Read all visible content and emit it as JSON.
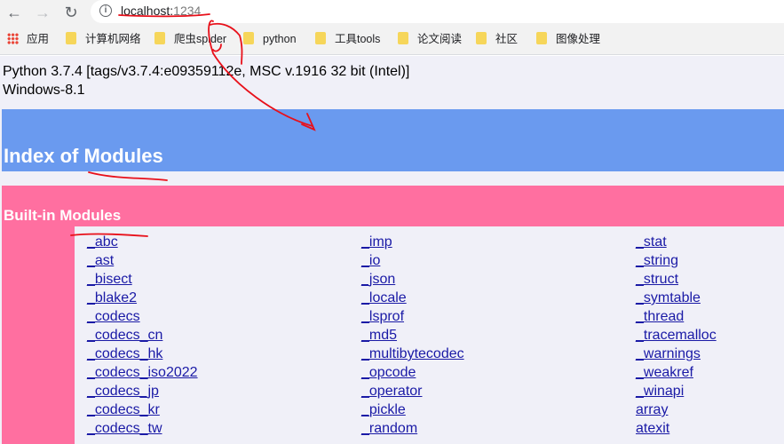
{
  "browser": {
    "url_host": "localhost:",
    "url_port": "1234",
    "info_glyph": "i"
  },
  "bookmarks": [
    {
      "label": "应用",
      "icon": "apps-grid-icon"
    },
    {
      "label": "计算机网络",
      "icon": "folder-icon"
    },
    {
      "label": "爬虫spider",
      "icon": "folder-icon"
    },
    {
      "label": "python",
      "icon": "folder-icon"
    },
    {
      "label": "工具tools",
      "icon": "folder-icon"
    },
    {
      "label": "论文阅读",
      "icon": "folder-icon"
    },
    {
      "label": "社区",
      "icon": "folder-icon"
    },
    {
      "label": "图像处理",
      "icon": "folder-icon"
    }
  ],
  "page": {
    "version_line": "Python 3.7.4 [tags/v3.7.4:e09359112e, MSC v.1916 32 bit (Intel)]",
    "platform_line": "Windows-8.1",
    "heading": "Index of Modules",
    "section_title": "Built-in Modules",
    "colors": {
      "heading_bg": "#6a9aef",
      "section_bg": "#ff6fa0",
      "page_bg": "#f0f0f8",
      "link": "#1a1aa6",
      "annotation": "#e8101a"
    }
  },
  "modules": {
    "col1": [
      "_abc",
      "_ast",
      "_bisect",
      "_blake2",
      "_codecs",
      "_codecs_cn",
      "_codecs_hk",
      "_codecs_iso2022",
      "_codecs_jp",
      "_codecs_kr",
      "_codecs_tw"
    ],
    "col2": [
      "_imp",
      "_io",
      "_json",
      "_locale",
      "_lsprof",
      "_md5",
      "_multibytecodec",
      "_opcode",
      "_operator",
      "_pickle",
      "_random"
    ],
    "col3": [
      "_stat",
      "_string",
      "_struct",
      "_symtable",
      "_thread",
      "_tracemalloc",
      "_warnings",
      "_weakref",
      "_winapi",
      "array",
      "atexit"
    ]
  }
}
